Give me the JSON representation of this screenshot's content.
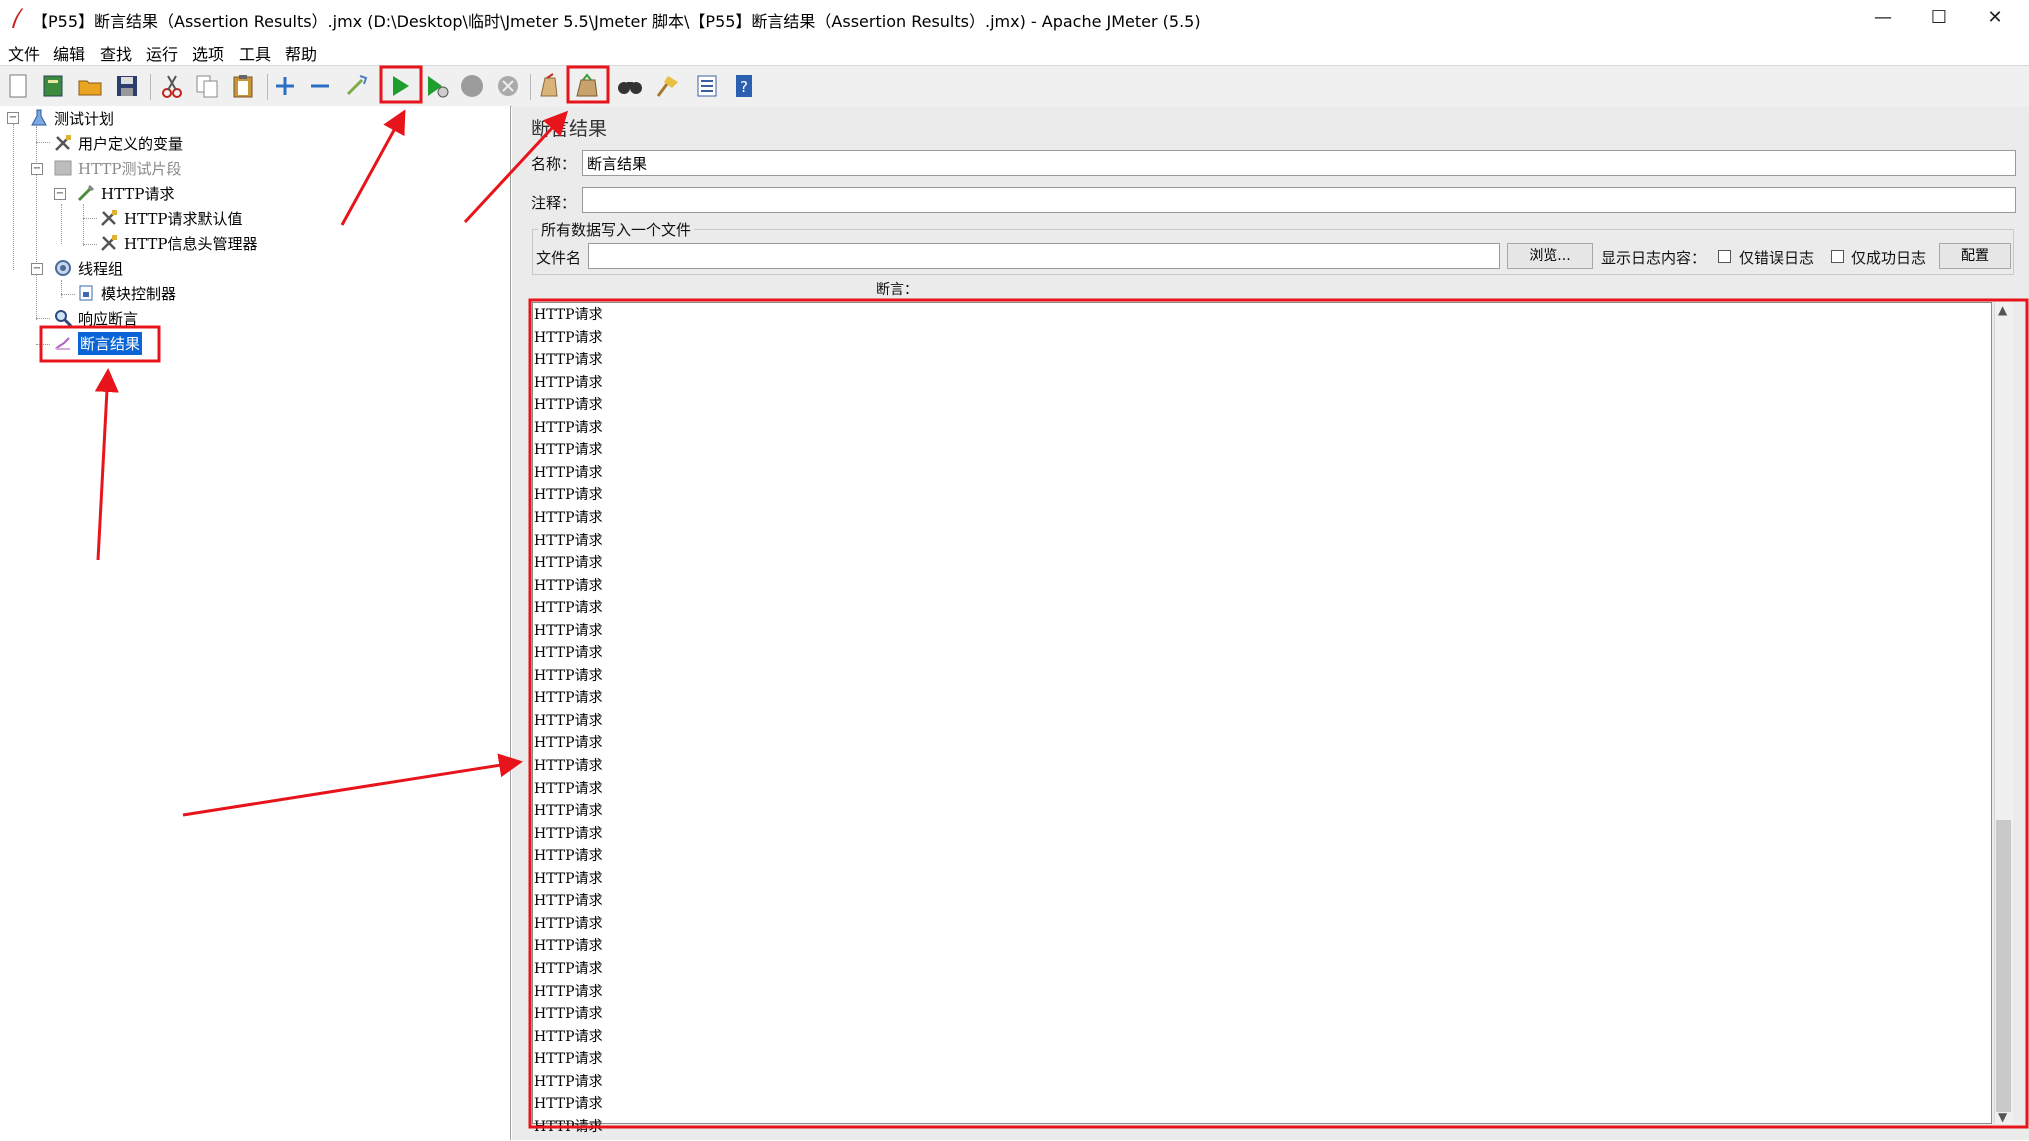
{
  "window": {
    "title": "【P55】断言结果（Assertion Results）.jmx (D:\\Desktop\\临时\\Jmeter 5.5\\Jmeter 脚本\\【P55】断言结果（Assertion Results）.jmx) - Apache JMeter (5.5)",
    "minimize": "—",
    "maximize": "☐",
    "close": "✕"
  },
  "menu": [
    "文件",
    "编辑",
    "查找",
    "运行",
    "选项",
    "工具",
    "帮助"
  ],
  "toolbar": {
    "icons": [
      "new-icon",
      "templates-icon",
      "open-icon",
      "save-icon",
      "cut-icon",
      "copy-icon",
      "paste-icon",
      "expand-icon",
      "collapse-icon",
      "toggle-icon",
      "start-icon",
      "start-no-timers-icon",
      "stop-icon",
      "shutdown-icon",
      "clear-icon",
      "clear-all-icon",
      "search-icon",
      "reset-search-icon",
      "function-helper-icon",
      "help-icon"
    ]
  },
  "tree": {
    "items": [
      {
        "label": "测试计划",
        "icon": "test-plan-icon"
      },
      {
        "label": "用户定义的变量",
        "icon": "config-element-icon"
      },
      {
        "label": "HTTP测试片段",
        "icon": "test-fragment-icon"
      },
      {
        "label": "HTTP请求",
        "icon": "http-sampler-icon"
      },
      {
        "label": "HTTP请求默认值",
        "icon": "config-element-icon"
      },
      {
        "label": "HTTP信息头管理器",
        "icon": "config-element-icon"
      },
      {
        "label": "线程组",
        "icon": "thread-group-icon"
      },
      {
        "label": "模块控制器",
        "icon": "module-controller-icon"
      },
      {
        "label": "响应断言",
        "icon": "assertion-icon"
      },
      {
        "label": "断言结果",
        "icon": "listener-icon"
      }
    ]
  },
  "panel": {
    "title": "断言结果",
    "name_label": "名称：",
    "name_value": "断言结果",
    "comment_label": "注释：",
    "comment_value": "",
    "file_group_legend": "所有数据写入一个文件",
    "filename_label": "文件名",
    "filename_value": "",
    "browse_button": "浏览...",
    "log_content_label": "显示日志内容：",
    "errors_only_label": "仅错误日志",
    "success_only_label": "仅成功日志",
    "configure_button": "配置",
    "assertions_label": "断言：",
    "results": [
      "HTTP请求",
      "HTTP请求",
      "HTTP请求",
      "HTTP请求",
      "HTTP请求",
      "HTTP请求",
      "HTTP请求",
      "HTTP请求",
      "HTTP请求",
      "HTTP请求",
      "HTTP请求",
      "HTTP请求",
      "HTTP请求",
      "HTTP请求",
      "HTTP请求",
      "HTTP请求",
      "HTTP请求",
      "HTTP请求",
      "HTTP请求",
      "HTTP请求",
      "HTTP请求",
      "HTTP请求",
      "HTTP请求",
      "HTTP请求",
      "HTTP请求",
      "HTTP请求",
      "HTTP请求",
      "HTTP请求",
      "HTTP请求",
      "HTTP请求",
      "HTTP请求",
      "HTTP请求",
      "HTTP请求",
      "HTTP请求",
      "HTTP请求",
      "HTTP请求",
      "HTTP请求"
    ]
  },
  "colors": {
    "annotation": "#e8141b",
    "selection": "#0a64d6",
    "start_green": "#1e9e2e"
  }
}
